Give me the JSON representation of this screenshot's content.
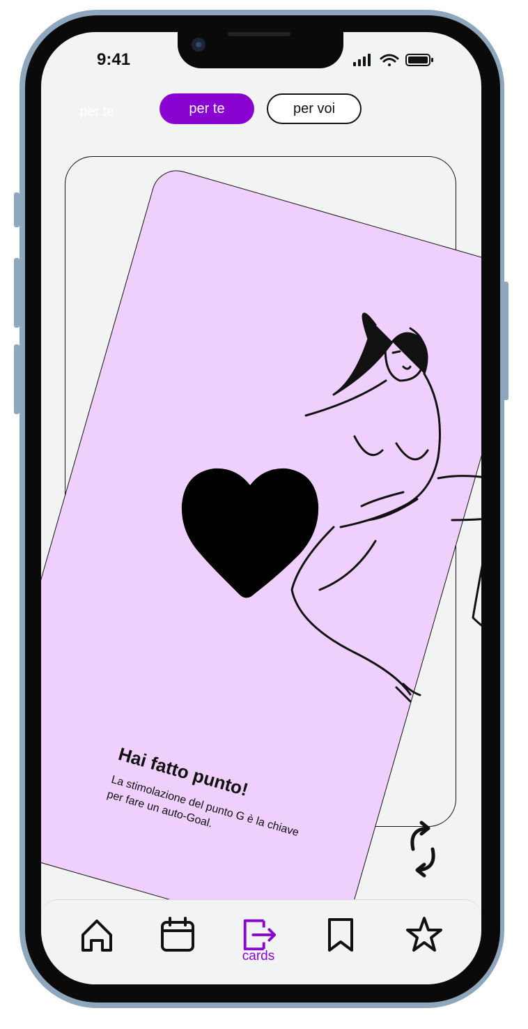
{
  "status_bar": {
    "time": "9:41"
  },
  "mode_toggle": {
    "ghost_label": "per te",
    "options": [
      "per te",
      "per voi"
    ],
    "selected": "per te"
  },
  "card": {
    "title": "Hai fatto punto!",
    "description": "La stimolazione del punto G è la chiave per fare un auto-Goal."
  },
  "tab_bar": {
    "items": [
      {
        "icon": "home-icon",
        "label": ""
      },
      {
        "icon": "calendar-icon",
        "label": ""
      },
      {
        "icon": "cards-icon",
        "label": "cards",
        "active": true
      },
      {
        "icon": "bookmark-icon",
        "label": ""
      },
      {
        "icon": "star-icon",
        "label": ""
      }
    ]
  },
  "colors": {
    "accent": "#8a04d1",
    "card_background": "#efd0fc",
    "screen_background": "#f2f4f3"
  }
}
